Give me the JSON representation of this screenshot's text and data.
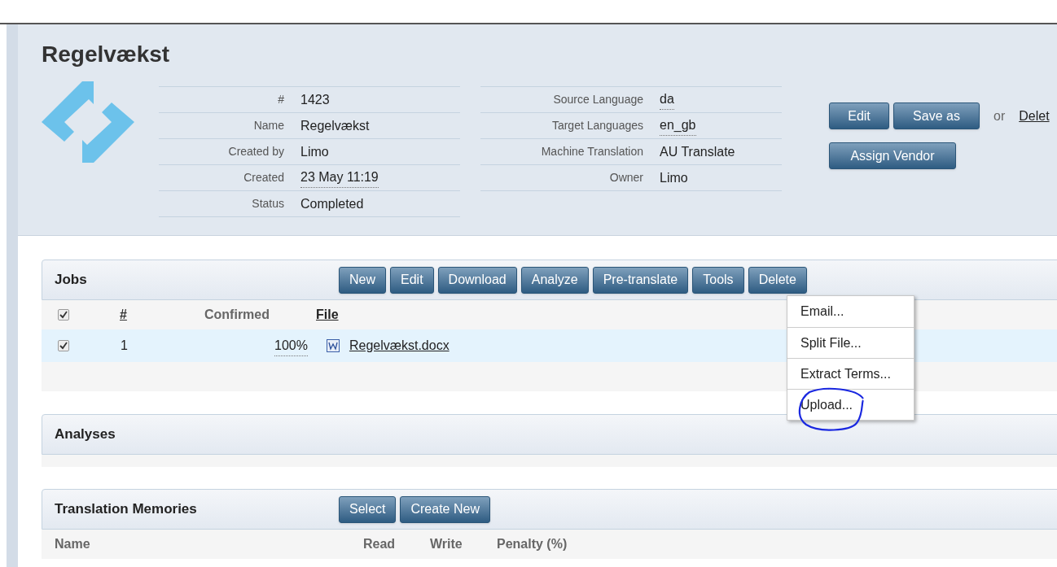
{
  "project": {
    "title": "Regelvækst",
    "details_left": [
      {
        "label": "#",
        "value": "1423",
        "dotted": false
      },
      {
        "label": "Name",
        "value": "Regelvækst",
        "dotted": false
      },
      {
        "label": "Created by",
        "value": "Limo",
        "dotted": false
      },
      {
        "label": "Created",
        "value": "23 May 11:19",
        "dotted": true
      },
      {
        "label": "Status",
        "value": "Completed",
        "dotted": false
      }
    ],
    "details_right": [
      {
        "label": "Source Language",
        "value": "da",
        "dotted": true
      },
      {
        "label": "Target Languages",
        "value": "en_gb",
        "dotted": true
      },
      {
        "label": "Machine Translation",
        "value": "AU Translate",
        "dotted": false
      },
      {
        "label": "Owner",
        "value": "Limo",
        "dotted": false
      }
    ],
    "actions": [
      "Edit",
      "Save as"
    ],
    "or_text": "or",
    "delete_link": "Delet",
    "assign_button": "Assign Vendor"
  },
  "jobs": {
    "title": "Jobs",
    "buttons": [
      "New",
      "Edit",
      "Download",
      "Analyze",
      "Pre-translate",
      "Tools",
      "Delete"
    ],
    "all_checked": true,
    "columns": [
      "#",
      "Confirmed",
      "File"
    ],
    "rows": [
      {
        "checked": true,
        "number": "1",
        "confirmed": "100%",
        "file": "Regelvækst.docx"
      }
    ]
  },
  "tools_menu": {
    "items": [
      {
        "label": "Email...",
        "circled": false
      },
      {
        "label": "Split File...",
        "circled": false
      },
      {
        "label": "Extract Terms...",
        "circled": false
      },
      {
        "label": "Upload...",
        "circled": true
      }
    ]
  },
  "analyses": {
    "title": "Analyses"
  },
  "translation_memories": {
    "title": "Translation Memories",
    "buttons": [
      "Select",
      "Create New"
    ],
    "columns": [
      "Name",
      "Read",
      "Write",
      "Penalty (%)"
    ]
  }
}
